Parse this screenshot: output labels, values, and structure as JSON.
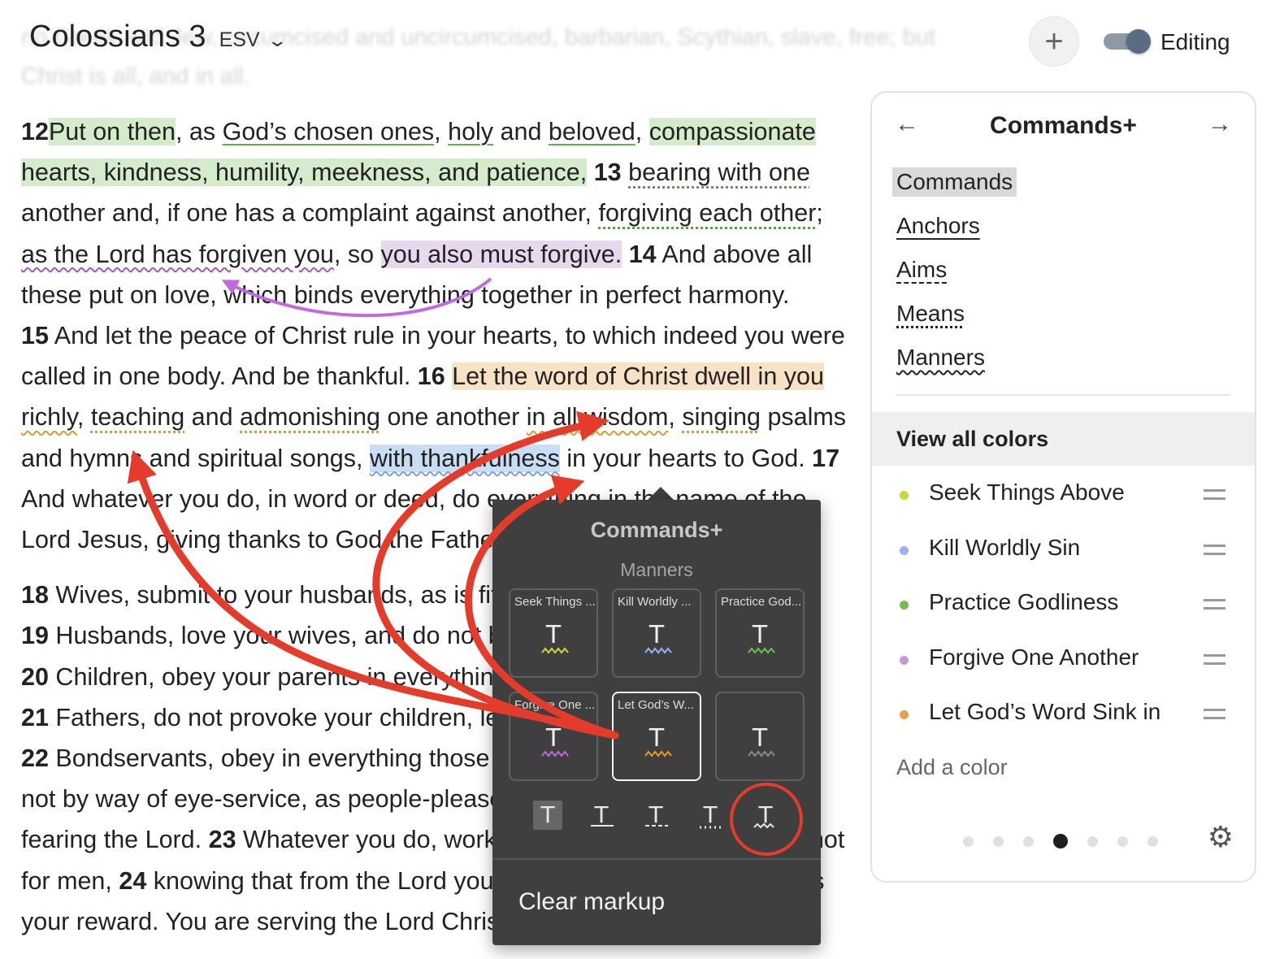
{
  "header": {
    "title": "Colossians 3",
    "version": "ESV",
    "editing_label": "Editing",
    "editing_on": true
  },
  "ghost_text": {
    "line1": "no Greek and Jew, circumcised and uncircumcised, barbarian, Scythian, slave, free; but",
    "line2": "Christ is all, and in all."
  },
  "passage": {
    "v12": {
      "num": "12",
      "put_on": "Put on then",
      "s1": ", as ",
      "chosen": "God’s chosen ones",
      "s2": ", ",
      "holy": "holy",
      "s3": " and ",
      "beloved": "beloved",
      "s4": ", ",
      "compassionate": "compassionate hearts, kindness, humility, meekness, and patience,",
      "s5": " "
    },
    "v13": {
      "num": "13",
      "s1": " ",
      "bearing": "bearing with one",
      "s2": " another and, if one has a complaint against another, ",
      "forgiving": "forgiving each other",
      "s3": "; ",
      "as_lord": "as the Lord has forgiven you",
      "s4": ", so ",
      "also": "you also must forgive.",
      "s5": " "
    },
    "v14": {
      "num": "14",
      "text": " And above all these put on love, which binds everything together in perfect harmony."
    },
    "v15": {
      "num": "15",
      "text": " And let the peace of Christ rule in your hearts, to which indeed you were called in one body. And be thankful. "
    },
    "v16": {
      "num": "16",
      "s1": " ",
      "word": "Let the word of Christ dwell in you",
      "s2": " ",
      "richly": "richly",
      "s3": ", ",
      "teaching": "teaching",
      "s4": " and ",
      "admonishing": "admonishing",
      "s5": " one another ",
      "wisdom": "in all wisdom",
      "s6": ", ",
      "singing": "singing",
      "s7": " psalms and hymns and spiritual songs, ",
      "thankfulness": "with thankfulness",
      "s8": " in your hearts to God. "
    },
    "v17": {
      "num": "17",
      "text": " And whatever you do, in word or deed, do everything in the name of the Lord Jesus, giving thanks to God the Father through him."
    },
    "v18": {
      "num": "18",
      "text": " Wives, submit to your husbands, as is fitting in the Lord."
    },
    "v19": {
      "num": "19",
      "text": " Husbands, love your wives, and do not be harsh with them."
    },
    "v20": {
      "num": "20",
      "text": " Children, obey your parents in everything, for this pleases the Lord."
    },
    "v21": {
      "num": "21",
      "text": " Fathers, do not provoke your children, lest they become discouraged."
    },
    "v22": {
      "num": "22",
      "text": " Bondservants, obey in everything those who are your earthly masters, not by way of eye-service, as people-pleasers, but with sincerity of heart, fearing the Lord. "
    },
    "v23": {
      "num": "23",
      "text": " Whatever you do, work heartily, as for the Lord and not for men, "
    },
    "v24": {
      "num": "24",
      "text": " knowing that from the Lord you will receive the inheritance as your reward. You are serving the Lord Christ."
    }
  },
  "panel": {
    "title": "Commands+",
    "prev_icon": "arrow-left-icon",
    "next_icon": "arrow-right-icon",
    "styles": [
      {
        "label": "Commands",
        "style": "highlight",
        "active": true
      },
      {
        "label": "Anchors",
        "style": "underline"
      },
      {
        "label": "Aims",
        "style": "dashed"
      },
      {
        "label": "Means",
        "style": "dotted"
      },
      {
        "label": "Manners",
        "style": "wavy"
      }
    ],
    "view_all": "View all colors",
    "colors": [
      {
        "label": "Seek Things Above",
        "color": "#cdd63a"
      },
      {
        "label": "Kill Worldly Sin",
        "color": "#9fb0f0"
      },
      {
        "label": "Practice Godliness",
        "color": "#6fbf4f"
      },
      {
        "label": "Forgive One Another",
        "color": "#c49ad6"
      },
      {
        "label": "Let God’s Word Sink in",
        "color": "#e3a24a"
      }
    ],
    "add_color": "Add a color",
    "page_count": 7,
    "active_page": 4,
    "gear_icon": "gear-icon"
  },
  "popup": {
    "title": "Commands+",
    "subtitle": "Manners",
    "tiles": [
      {
        "label": "Seek Things ...",
        "color": "#cdd63a",
        "selected": false
      },
      {
        "label": "Kill Worldly ...",
        "color": "#9fb0f0",
        "selected": false
      },
      {
        "label": "Practice God...",
        "color": "#6fbf4f",
        "selected": false
      },
      {
        "label": "Forgive One ...",
        "color": "#c069d8",
        "selected": false
      },
      {
        "label": "Let God’s W...",
        "color": "#e69a2e",
        "selected": true
      },
      {
        "label": "",
        "color": "#8a8a8a",
        "selected": false
      }
    ],
    "style_glyph": "T",
    "selected_style": "wavy",
    "clear_label": "Clear markup"
  },
  "annotations": {
    "arrow_color": "#e53b2a",
    "purple_arrow_color": "#c069e0"
  }
}
